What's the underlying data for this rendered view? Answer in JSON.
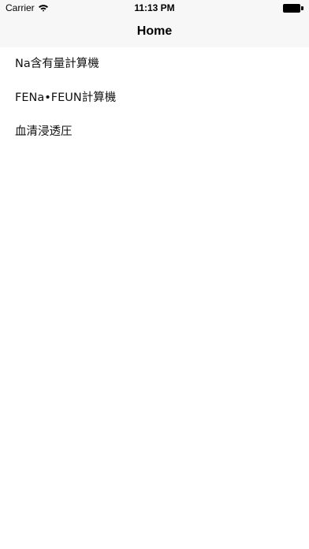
{
  "status_bar": {
    "carrier": "Carrier",
    "time": "11:13 PM",
    "wifi_icon": "wifi-icon",
    "battery_icon": "battery-full-icon"
  },
  "navbar": {
    "title": "Home"
  },
  "menu": {
    "items": [
      {
        "label": "Na含有量計算機"
      },
      {
        "label": "FENa•FEUN計算機"
      },
      {
        "label": "血清浸透圧"
      }
    ]
  },
  "colors": {
    "navbar_background": "#f7f7f7",
    "background": "#ffffff",
    "text": "#000000"
  }
}
